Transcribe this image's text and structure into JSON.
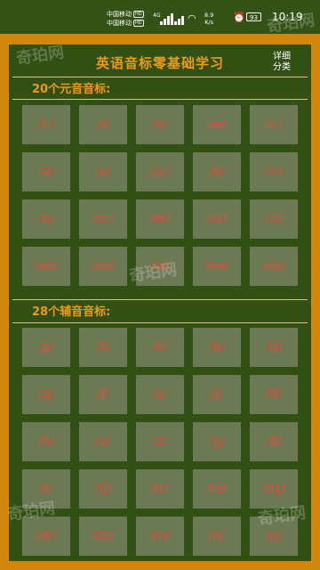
{
  "status_bar": {
    "carrier1": "中国移动",
    "carrier2": "中国移动",
    "hd_badge": "HD",
    "network": "4G",
    "speed_value": "8.9",
    "speed_unit": "K/s",
    "battery": "93",
    "time": "10:19"
  },
  "header": {
    "title": "英语音标零基础学习",
    "detail_line1": "详细",
    "detail_line2": "分类"
  },
  "vowels": {
    "title": "20个元音音标:",
    "items": [
      "/iː/",
      "/i/",
      "/e/",
      "/æ/",
      "/ɜː/",
      "/ə/",
      "/ʌ/",
      "/uː/",
      "/ʊ/",
      "/ɔː/",
      "/ɒ/",
      "/ɑː/",
      "/ei/",
      "/ai/",
      "/ɔi/",
      "/aʊ/",
      "/əʊ/",
      "/iə/",
      "/eə/",
      "/ʊə/"
    ]
  },
  "consonants": {
    "title": "28个辅音音标:",
    "items": [
      "/p/",
      "/t/",
      "/k/",
      "/b/",
      "/d/",
      "/g/",
      "/f/",
      "/s/",
      "/ʃ/",
      "/θ/",
      "/h/",
      "/v/",
      "/z/",
      "/ʒ/",
      "/ð/",
      "/r/",
      "/tʃ/",
      "/tr/",
      "/ts/",
      "/dʒ/",
      "/dr/",
      "/dz/",
      "/m/",
      "/n/",
      "/ŋ/"
    ]
  },
  "watermark": "奇珀网"
}
